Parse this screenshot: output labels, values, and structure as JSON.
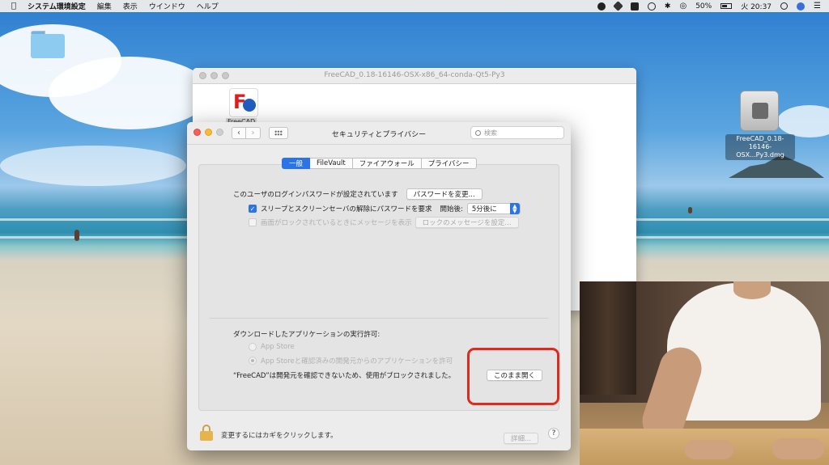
{
  "menubar": {
    "app_name": "システム環境設定",
    "menus": [
      "編集",
      "表示",
      "ウインドウ",
      "ヘルプ"
    ],
    "battery": "50%",
    "clock": "火 20:37",
    "status_icons": [
      "stop-icon",
      "dropbox-icon",
      "text-input-icon",
      "time-machine-icon",
      "bluetooth-icon",
      "wifi-icon",
      "battery-icon",
      "search-icon",
      "siri-icon",
      "list-icon"
    ]
  },
  "desktop": {
    "folder_label": "---",
    "dmg_label": "FreeCAD_0.18-16146-OSX...Py3.dmg"
  },
  "finder_window": {
    "title": "FreeCAD_0.18-16146-OSX-x86_64-conda-Qt5-Py3",
    "app_icon_label": "FreeCAD"
  },
  "prefs_window": {
    "title": "セキュリティとプライバシー",
    "search_placeholder": "検索",
    "tabs": [
      {
        "label": "一般",
        "active": true
      },
      {
        "label": "FileVault",
        "active": false
      },
      {
        "label": "ファイアウォール",
        "active": false
      },
      {
        "label": "プライバシー",
        "active": false
      }
    ],
    "password_set_text": "このユーザのログインパスワードが設定されています",
    "change_password_button": "パスワードを変更...",
    "require_password_label": "スリープとスクリーンセーバの解除にパスワードを要求",
    "require_password_checked": true,
    "start_after_label": "開始後:",
    "start_after_value": "5分後に",
    "lock_message_label": "画面がロックされているときにメッセージを表示",
    "lock_message_checked": false,
    "set_lock_message_button": "ロックのメッセージを設定...",
    "download_heading": "ダウンロードしたアプリケーションの実行許可:",
    "radio_options": [
      {
        "label": "App Store",
        "selected": false
      },
      {
        "label": "App Storeと確認済みの開発元からのアプリケーションを許可",
        "selected": true
      }
    ],
    "blocked_message": "“FreeCAD”は開発元を確認できないため、使用がブロックされました。",
    "open_anyway_button": "このまま開く",
    "lock_text": "変更するにはカギをクリックします。",
    "advanced_button": "詳細...",
    "help_button": "?"
  },
  "colors": {
    "accent": "#2a74e8",
    "highlight": "#e02a1f"
  }
}
